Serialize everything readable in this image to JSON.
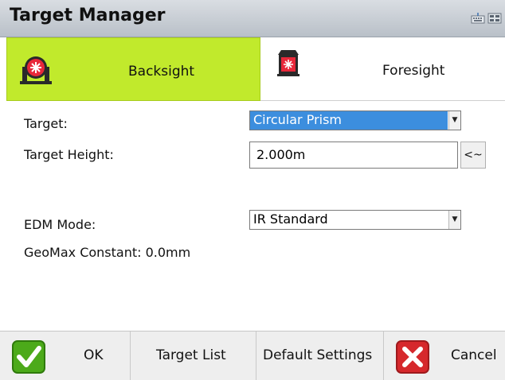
{
  "window": {
    "title": "Target Manager"
  },
  "status_icons": [
    "keyboard-icon",
    "battery-icon"
  ],
  "tabs": [
    {
      "label": "Backsight",
      "icon": "prism-on-pole-icon",
      "active": true
    },
    {
      "label": "Foresight",
      "icon": "prism-target-icon",
      "active": false
    }
  ],
  "form": {
    "target_label": "Target:",
    "target_value": "Circular Prism",
    "height_label": "Target Height:",
    "height_value": "2.000m",
    "height_button": "<~",
    "edm_label": "EDM Mode:",
    "edm_value": "IR Standard",
    "constant_text": "GeoMax Constant: 0.0mm"
  },
  "buttons": {
    "ok": "OK",
    "target_list": "Target List",
    "default_settings": "Default Settings",
    "cancel": "Cancel"
  },
  "colors": {
    "active_tab": "#c1ea2c",
    "selection": "#3c8ede",
    "ok_green": "#4caa1a",
    "cancel_red": "#d6282c"
  }
}
